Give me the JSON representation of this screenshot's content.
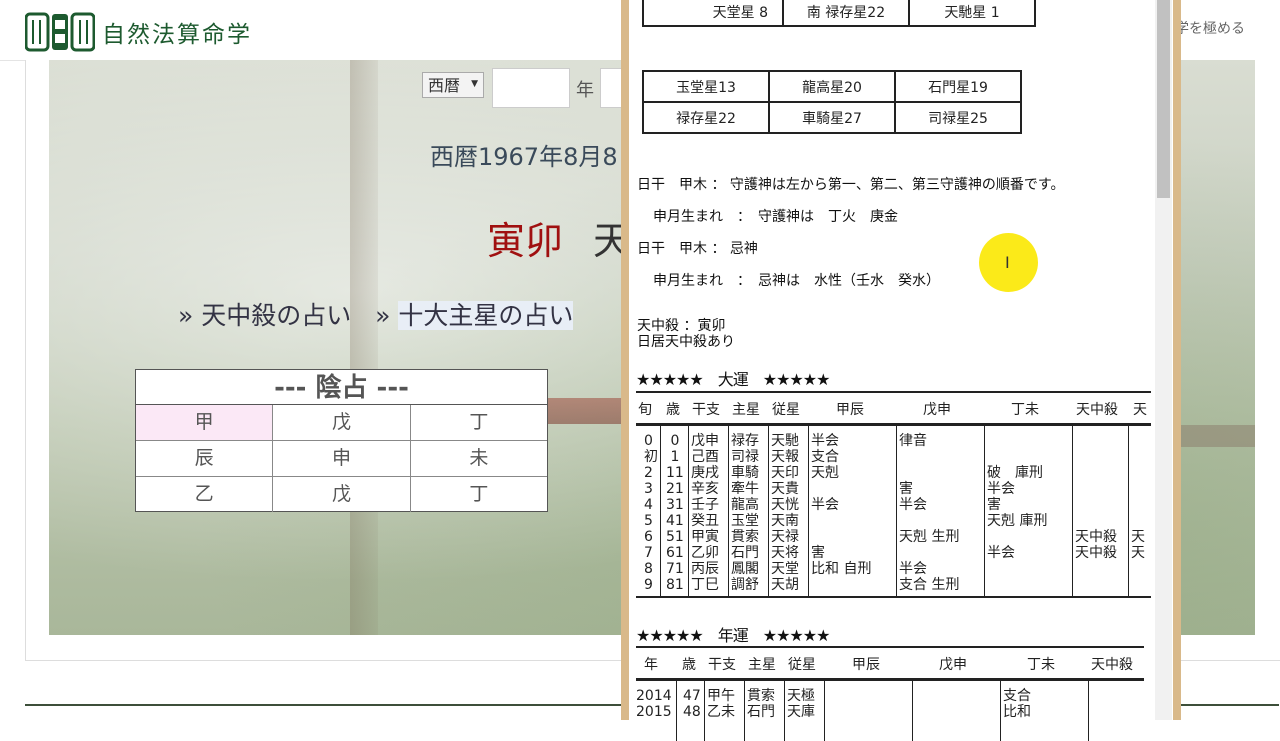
{
  "header": {
    "logo_text": "自然法算命学",
    "right_text": "学を極める"
  },
  "form": {
    "era_select": "西暦",
    "year_label": "年"
  },
  "main": {
    "date_line": "西暦1967年8月8",
    "ganshi_red": "寅卯",
    "ganshi_rest": "天",
    "link1": "» 天中殺の占い",
    "link2_prefix": "» ",
    "link2": "十大主星の占い"
  },
  "yin_table": {
    "title": "--- 陰占 ---",
    "rows": [
      [
        "甲",
        "戊",
        "丁"
      ],
      [
        "辰",
        "申",
        "未"
      ],
      [
        "乙",
        "戊",
        "丁"
      ]
    ]
  },
  "popup": {
    "star_table1": [
      [
        "天堂星 8",
        "南 禄存星22",
        "天馳星 1"
      ]
    ],
    "star_table2": [
      [
        "玉堂星13",
        "龍高星20",
        "石門星19"
      ],
      [
        "禄存星22",
        "車騎星27",
        "司禄星25"
      ]
    ],
    "guardian_line1": "日干　甲木 ： 守護神は左から第一、第二、第三守護神の順番です。",
    "guardian_line2": "申月生まれ　：　守護神は　丁火　庚金",
    "imi_line1": "日干　甲木 ： 忌神",
    "imi_line2": "申月生まれ　：　忌神は　水性（壬水　癸水）",
    "tenchusatsu": "天中殺 ：寅卯",
    "nichikyo": "日居天中殺あり",
    "taiun_title": "★★★★★　大運　★★★★★",
    "taiun_headers": [
      "旬",
      "歳",
      "干支",
      "主星",
      "従星",
      "甲辰",
      "戊申",
      "丁未",
      "天中殺",
      "天"
    ],
    "taiun_col_jun": "0\n初\n2\n3\n4\n5\n6\n7\n8\n9",
    "taiun_col_age": " 0\n 1\n11\n21\n31\n41\n51\n61\n71\n81",
    "taiun_col_kanshi": "戊申\n己酉\n庚戌\n辛亥\n壬子\n癸丑\n甲寅\n乙卯\n丙辰\n丁巳",
    "taiun_col_main": "禄存\n司禄\n車騎\n牽牛\n龍高\n玉堂\n貫索\n石門\n鳳閣\n調舒",
    "taiun_col_sub": "天馳\n天報\n天印\n天貴\n天恍\n天南\n天禄\n天将\n天堂\n天胡",
    "taiun_col_c1": "半会\n支合\n天剋\n\n半会\n\n\n害\n比和 自刑\n",
    "taiun_col_c2": "律音\n\n\n害\n半会\n\n天剋 生刑\n\n半会\n支合 生刑",
    "taiun_col_c3": "\n\n破　庫刑\n半会\n害\n天剋 庫刑\n\n半会\n\n",
    "taiun_col_c4": "\n\n\n\n\n\n天中殺\n天中殺\n\n",
    "taiun_col_c5": "\n\n\n\n\n\n天\n天\n\n",
    "nenun_title": "★★★★★　年運　★★★★★",
    "nenun_headers": [
      "年",
      "歳",
      "干支",
      "主星",
      "従星",
      "甲辰",
      "戊申",
      "丁未",
      "天中殺"
    ],
    "nenun_col_year": "2014\n2015",
    "nenun_col_age": "47\n48",
    "nenun_col_kanshi": "甲午\n乙未",
    "nenun_col_main": "貫索\n石門",
    "nenun_col_sub": "天極\n天庫",
    "nenun_col_c3": "支合\n比和"
  },
  "colors": {
    "accent_red": "#a01010",
    "logo_green": "#1d5a2f",
    "popup_border": "#d9b98a",
    "cursor_highlight": "#fbe800"
  }
}
